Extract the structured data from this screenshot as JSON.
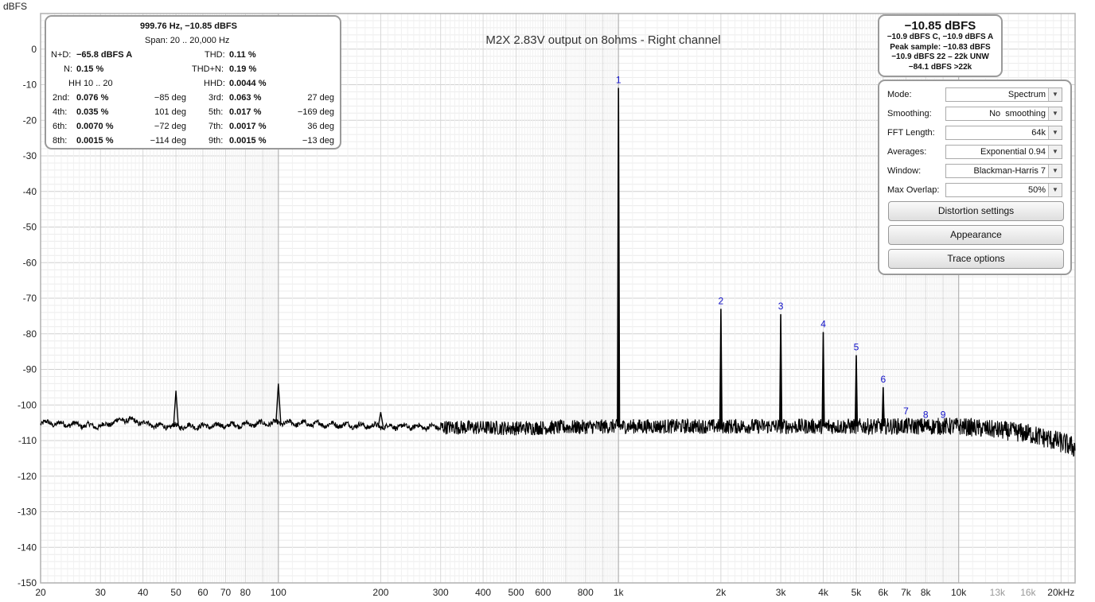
{
  "chart_data": {
    "type": "line",
    "title": "M2X 2.83V output on 8ohms - Right channel",
    "ylabel": "dBFS",
    "xscale": "log",
    "xlim": [
      20,
      22000
    ],
    "ylim": [
      -150,
      10
    ],
    "grid": true,
    "y_ticks": [
      "0",
      "-10",
      "-20",
      "-30",
      "-40",
      "-50",
      "-60",
      "-70",
      "-80",
      "-90",
      "-100",
      "-110",
      "-120",
      "-130",
      "-140",
      "-150"
    ],
    "x_ticks": [
      {
        "v": 20,
        "label": "20"
      },
      {
        "v": 30,
        "label": "30"
      },
      {
        "v": 40,
        "label": "40"
      },
      {
        "v": 50,
        "label": "50"
      },
      {
        "v": 60,
        "label": "60"
      },
      {
        "v": 70,
        "label": "70"
      },
      {
        "v": 80,
        "label": "80"
      },
      {
        "v": 100,
        "label": "100"
      },
      {
        "v": 200,
        "label": "200"
      },
      {
        "v": 300,
        "label": "300"
      },
      {
        "v": 400,
        "label": "400"
      },
      {
        "v": 500,
        "label": "500"
      },
      {
        "v": 600,
        "label": "600"
      },
      {
        "v": 800,
        "label": "800"
      },
      {
        "v": 1000,
        "label": "1k"
      },
      {
        "v": 2000,
        "label": "2k"
      },
      {
        "v": 3000,
        "label": "3k"
      },
      {
        "v": 4000,
        "label": "4k"
      },
      {
        "v": 5000,
        "label": "5k"
      },
      {
        "v": 6000,
        "label": "6k"
      },
      {
        "v": 7000,
        "label": "7k"
      },
      {
        "v": 8000,
        "label": "8k"
      },
      {
        "v": 10000,
        "label": "10k"
      },
      {
        "v": 13000,
        "label": "13k",
        "grey": true
      },
      {
        "v": 16000,
        "label": "16k",
        "grey": true
      },
      {
        "v": 20000,
        "label": "20kHz"
      }
    ],
    "series": [
      {
        "color": "#000000",
        "noise_floor": [
          [
            20,
            -105
          ],
          [
            25,
            -105.5
          ],
          [
            30,
            -106
          ],
          [
            35,
            -104
          ],
          [
            40,
            -105
          ],
          [
            45,
            -106
          ],
          [
            60,
            -106
          ],
          [
            80,
            -105.5
          ],
          [
            100,
            -105
          ],
          [
            200,
            -106
          ],
          [
            500,
            -106.5
          ],
          [
            1000,
            -106
          ],
          [
            2000,
            -106
          ],
          [
            5000,
            -106
          ],
          [
            10000,
            -106
          ],
          [
            13000,
            -107
          ],
          [
            16000,
            -108
          ],
          [
            20000,
            -110.5
          ],
          [
            22000,
            -112
          ]
        ],
        "peaks": [
          {
            "x": 50,
            "y": -96
          },
          {
            "x": 100,
            "y": -94
          },
          {
            "x": 200,
            "y": -102
          },
          {
            "x": 1000,
            "y": -10.9
          },
          {
            "x": 2000,
            "y": -73
          },
          {
            "x": 3000,
            "y": -74.5
          },
          {
            "x": 4000,
            "y": -79.5
          },
          {
            "x": 5000,
            "y": -86
          },
          {
            "x": 6000,
            "y": -95
          },
          {
            "x": 7000,
            "y": -104
          },
          {
            "x": 8000,
            "y": -105
          },
          {
            "x": 9000,
            "y": -105
          }
        ]
      }
    ],
    "harmonic_labels": [
      {
        "n": "1",
        "x": 1000,
        "y": -10.9
      },
      {
        "n": "2",
        "x": 2000,
        "y": -73
      },
      {
        "n": "3",
        "x": 3000,
        "y": -74.5
      },
      {
        "n": "4",
        "x": 4000,
        "y": -79.5
      },
      {
        "n": "5",
        "x": 5000,
        "y": -86
      },
      {
        "n": "6",
        "x": 6000,
        "y": -95
      },
      {
        "n": "7",
        "x": 7000,
        "y": -104
      },
      {
        "n": "8",
        "x": 8000,
        "y": -105
      },
      {
        "n": "9",
        "x": 9000,
        "y": -105
      }
    ]
  },
  "distortion": {
    "header": "999.76 Hz, −10.85 dBFS",
    "span": "Span: 20 .. 20,000 Hz",
    "nd_label": "N+D:",
    "nd_value": "−65.8 dBFS A",
    "thd_label": "THD:",
    "thd_value": "0.11 %",
    "n_label": "N:",
    "n_value": "0.15 %",
    "thdn_label": "THD+N:",
    "thdn_value": "0.19 %",
    "hh_label": "HH 10 .. 20",
    "hhd_label": "HHD:",
    "hhd_value": "0.0044 %",
    "harmonics": [
      {
        "l1": "2nd:",
        "v1": "0.076 %",
        "d1": "−85 deg",
        "l2": "3rd:",
        "v2": "0.063 %",
        "d2": "27 deg"
      },
      {
        "l1": "4th:",
        "v1": "0.035 %",
        "d1": "101 deg",
        "l2": "5th:",
        "v2": "0.017 %",
        "d2": "−169 deg"
      },
      {
        "l1": "6th:",
        "v1": "0.0070 %",
        "d1": "−72 deg",
        "l2": "7th:",
        "v2": "0.0017 %",
        "d2": "36 deg"
      },
      {
        "l1": "8th:",
        "v1": "0.0015 %",
        "d1": "−114 deg",
        "l2": "9th:",
        "v2": "0.0015 %",
        "d2": "−13 deg"
      }
    ]
  },
  "level": {
    "main": "−10.85 dBFS",
    "line1": "−10.9 dBFS C, −10.9 dBFS A",
    "line2": "Peak sample: −10.83 dBFS",
    "line3": "−10.9 dBFS 22 – 22k UNW",
    "line4": "−84.1 dBFS >22k"
  },
  "settings": {
    "mode_label": "Mode:",
    "mode_value": "Spectrum",
    "smoothing_label": "Smoothing:",
    "smoothing_value": "No  smoothing",
    "fft_label": "FFT Length:",
    "fft_value": "64k",
    "averages_label": "Averages:",
    "averages_value": "Exponential 0.94",
    "window_label": "Window:",
    "window_value": "Blackman-Harris 7",
    "overlap_label": "Max Overlap:",
    "overlap_value": "50%",
    "btn_distortion": "Distortion settings",
    "btn_appearance": "Appearance",
    "btn_trace": "Trace options"
  }
}
